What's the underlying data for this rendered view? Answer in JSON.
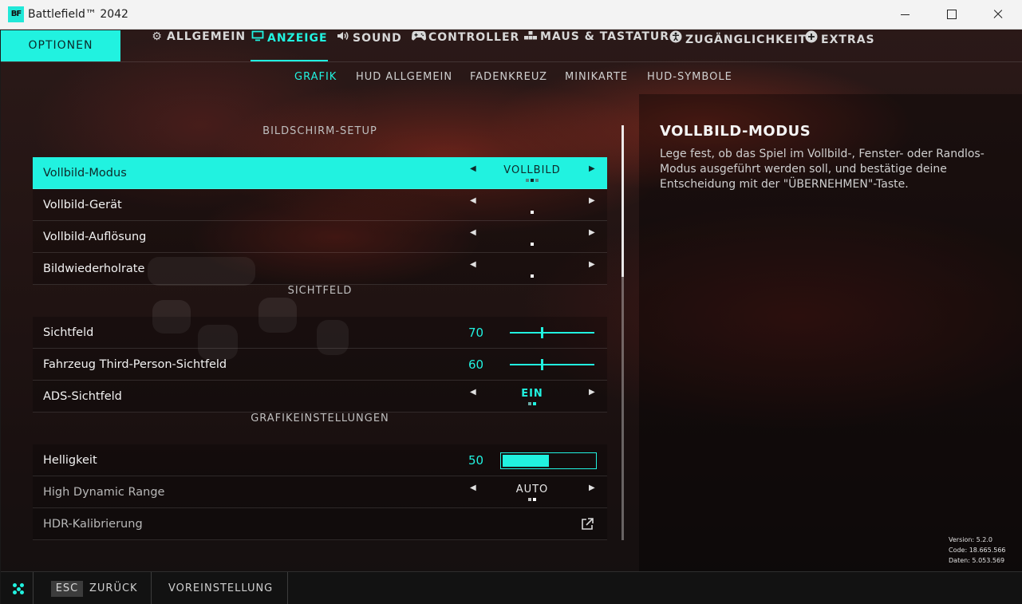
{
  "window": {
    "title": "Battlefield™ 2042",
    "logo_text": "BF"
  },
  "section_tab": "OPTIONEN",
  "nav": [
    {
      "label": "ALLGEMEIN",
      "icon": "gear-icon",
      "active": false
    },
    {
      "label": "ANZEIGE",
      "icon": "monitor-icon",
      "active": true
    },
    {
      "label": "SOUND",
      "icon": "speaker-icon",
      "active": false
    },
    {
      "label": "CONTROLLER",
      "icon": "gamepad-icon",
      "active": false
    },
    {
      "label": "MAUS & TASTATUR",
      "icon": "keyboard-icon",
      "active": false
    },
    {
      "label": "ZUGÄNGLICHKEIT",
      "icon": "accessibility-icon",
      "active": false
    },
    {
      "label": "EXTRAS",
      "icon": "plus-circle-icon",
      "active": false
    }
  ],
  "subnav": [
    {
      "label": "GRAFIK",
      "active": true
    },
    {
      "label": "HUD ALLGEMEIN",
      "active": false
    },
    {
      "label": "FADENKREUZ",
      "active": false
    },
    {
      "label": "MINIKARTE",
      "active": false
    },
    {
      "label": "HUD-SYMBOLE",
      "active": false
    }
  ],
  "groups": {
    "screen_setup": "BILDSCHIRM-SETUP",
    "fov": "SICHTFELD",
    "graphics": "GRAFIKEINSTELLUNGEN"
  },
  "settings": {
    "fullscreen_mode": {
      "label": "Vollbild-Modus",
      "value": "VOLLBILD",
      "option_count": 3,
      "option_index": 1
    },
    "fullscreen_device": {
      "label": "Vollbild-Gerät",
      "value": "",
      "option_count": 1,
      "option_index": 0
    },
    "fullscreen_resolution": {
      "label": "Vollbild-Auflösung",
      "value": "",
      "option_count": 1,
      "option_index": 0
    },
    "refresh_rate": {
      "label": "Bildwiederholrate",
      "value": "",
      "option_count": 1,
      "option_index": 0
    },
    "fov": {
      "label": "Sichtfeld",
      "value": "70",
      "slider_level": 0.38
    },
    "vehicle_fov": {
      "label": "Fahrzeug Third-Person-Sichtfeld",
      "value": "60",
      "slider_level": 0.38
    },
    "ads_fov": {
      "label": "ADS-Sichtfeld",
      "value": "EIN",
      "option_count": 2,
      "option_index": 1
    },
    "brightness": {
      "label": "Helligkeit",
      "value": "50",
      "bar_level": 0.5
    },
    "hdr": {
      "label": "High Dynamic Range",
      "value": "AUTO",
      "option_count": 2,
      "option_index": 1
    },
    "hdr_calibration": {
      "label": "HDR-Kalibrierung",
      "icon": "external-link-icon"
    }
  },
  "info": {
    "title": "VOLLBILD-MODUS",
    "text": "Lege fest, ob das Spiel im Vollbild-, Fenster- oder Randlos-Modus ausgeführt werden soll, und bestätige deine Entscheidung mit der \"ÜBERNEHMEN\"-Taste."
  },
  "version": {
    "version_line": "Version: 5.2.0",
    "code_line": "Code: 18.665.566",
    "data_line": "Daten: 5.053.569"
  },
  "footer": {
    "esc_key": "ESC",
    "back_label": "ZURÜCK",
    "preset_label": "VOREINSTELLUNG"
  },
  "colors": {
    "accent": "#21f2e0"
  }
}
